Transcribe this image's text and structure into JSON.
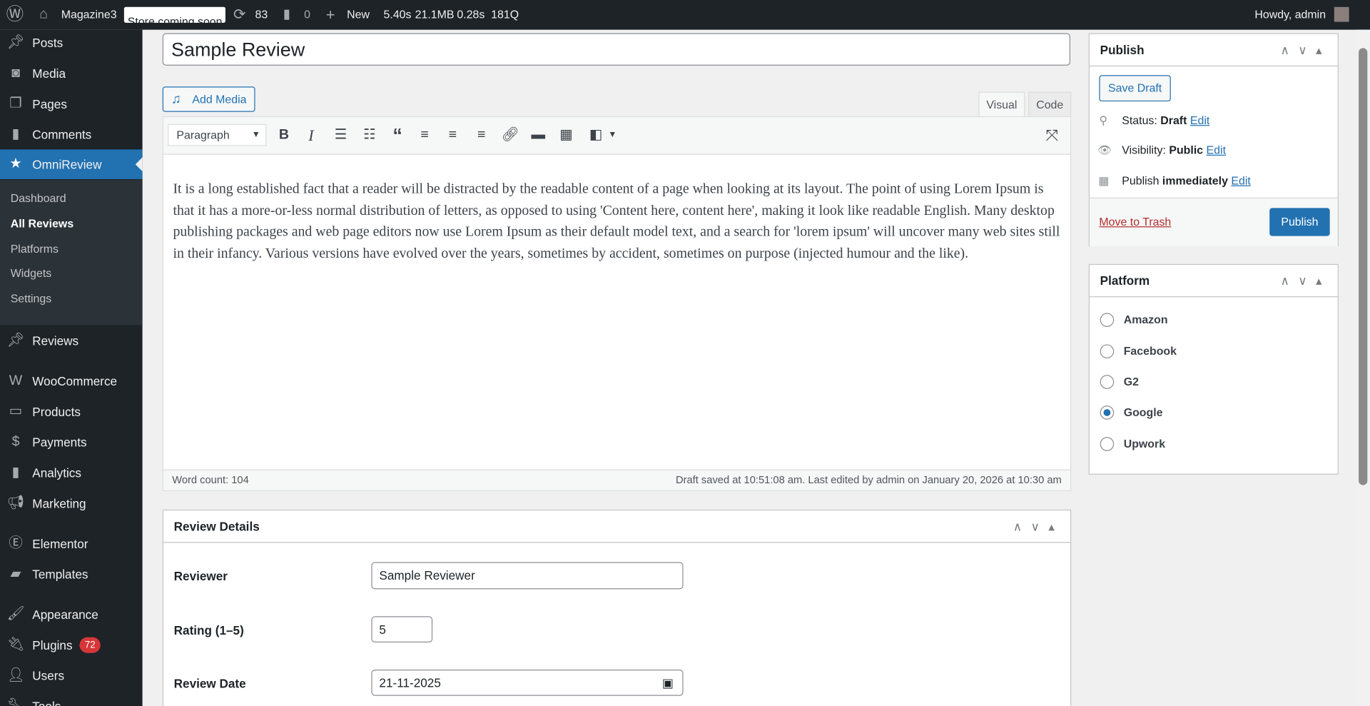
{
  "adminbar": {
    "site": "Magazine3",
    "store_badge": "Store coming soon",
    "updates": "83",
    "comments": "0",
    "new_label": "New",
    "perf": [
      "5.40s",
      "21.1MB",
      "0.28s",
      "181Q"
    ],
    "howdy": "Howdy, admin"
  },
  "sidebar": {
    "items_top": [
      {
        "label": "Posts",
        "icon": "pin"
      },
      {
        "label": "Media",
        "icon": "media"
      },
      {
        "label": "Pages",
        "icon": "pages"
      },
      {
        "label": "Comments",
        "icon": "comment"
      }
    ],
    "active": {
      "label": "OmniReview",
      "icon": "star"
    },
    "submenu": [
      "Dashboard",
      "All Reviews",
      "Platforms",
      "Widgets",
      "Settings"
    ],
    "items_bottom": [
      {
        "label": "Reviews",
        "icon": "pin"
      },
      {
        "label": "WooCommerce",
        "icon": "woo"
      },
      {
        "label": "Products",
        "icon": "box"
      },
      {
        "label": "Payments",
        "icon": "dollar"
      },
      {
        "label": "Analytics",
        "icon": "bars"
      },
      {
        "label": "Marketing",
        "icon": "megaphone"
      },
      {
        "label": "Elementor",
        "icon": "elementor"
      },
      {
        "label": "Templates",
        "icon": "folder"
      },
      {
        "label": "Appearance",
        "icon": "brush"
      },
      {
        "label": "Plugins",
        "icon": "plug",
        "badge": "72"
      },
      {
        "label": "Users",
        "icon": "user"
      },
      {
        "label": "Tools",
        "icon": "wrench"
      }
    ]
  },
  "editor": {
    "title": "Sample Review",
    "add_media": "Add Media",
    "tabs": [
      "Visual",
      "Code"
    ],
    "format": "Paragraph",
    "content": "It is a long established fact that a reader will be distracted by the readable content of a page when looking at its layout. The point of using Lorem Ipsum is that it has a more-or-less normal distribution of letters, as opposed to using 'Content here, content here', making it look like readable English. Many desktop publishing packages and web page editors now use Lorem Ipsum as their default model text, and a search for 'lorem ipsum' will uncover many web sites still in their infancy. Various versions have evolved over the years, sometimes by accident, sometimes on purpose (injected humour and the like).",
    "word_count": "Word count: 104",
    "saved": "Draft saved at 10:51:08 am. Last edited by admin on January 20, 2026 at 10:30 am"
  },
  "review_details": {
    "title": "Review Details",
    "fields": [
      {
        "label": "Reviewer",
        "value": "Sample Reviewer"
      },
      {
        "label": "Rating (1–5)",
        "value": "5"
      },
      {
        "label": "Review Date",
        "value": "21-11-2025"
      }
    ]
  },
  "publish": {
    "title": "Publish",
    "save_draft": "Save Draft",
    "status_label": "Status:",
    "status": "Draft",
    "visibility_label": "Visibility:",
    "visibility": "Public",
    "publish_label": "Publish",
    "publish_when": "immediately",
    "edit": "Edit",
    "trash": "Move to Trash",
    "publish_button": "Publish"
  },
  "platform": {
    "title": "Platform",
    "options": [
      "Amazon",
      "Facebook",
      "G2",
      "Google",
      "Upwork"
    ],
    "selected": "Google"
  },
  "colors": {
    "accent": "#2271b1",
    "adminbar": "#1d2327",
    "danger": "#d63638"
  }
}
